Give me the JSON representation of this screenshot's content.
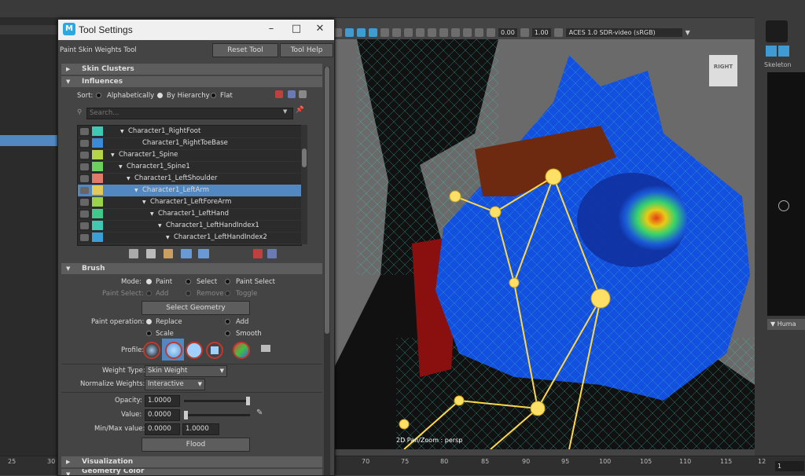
{
  "window": {
    "title": "Tool Settings",
    "tool_name": "Paint Skin Weights Tool",
    "reset_label": "Reset Tool",
    "help_label": "Tool Help",
    "logo": "M"
  },
  "sections": {
    "skin_clusters": "Skin Clusters",
    "influences": "Influences",
    "brush": "Brush",
    "visualization": "Visualization",
    "geometry_color": "Geometry Color"
  },
  "sort": {
    "label": "Sort:",
    "options": [
      "Alphabetically",
      "By Hierarchy",
      "Flat"
    ],
    "selected": "By Hierarchy"
  },
  "search": {
    "placeholder": "Search..."
  },
  "influences": [
    {
      "name": "Character1_RightFoot",
      "color": "#3fc9b5",
      "indent": 64,
      "arrow": true
    },
    {
      "name": "Character1_RightToeBase",
      "color": "#3a8ad6",
      "indent": 82,
      "arrow": false
    },
    {
      "name": "Character1_Spine",
      "color": "#b6d44a",
      "indent": 52,
      "arrow": true
    },
    {
      "name": "Character1_Spine1",
      "color": "#6bd05e",
      "indent": 62,
      "arrow": true
    },
    {
      "name": "Character1_LeftShoulder",
      "color": "#e07a6a",
      "indent": 72,
      "arrow": true
    },
    {
      "name": "Character1_LeftArm",
      "color": "#e3c85a",
      "indent": 82,
      "arrow": true,
      "selected": true
    },
    {
      "name": "Character1_LeftForeArm",
      "color": "#9ad34a",
      "indent": 92,
      "arrow": true
    },
    {
      "name": "Character1_LeftHand",
      "color": "#3fc98a",
      "indent": 102,
      "arrow": true
    },
    {
      "name": "Character1_LeftHandIndex1",
      "color": "#3ec9b0",
      "indent": 112,
      "arrow": true
    },
    {
      "name": "Character1_LeftHandIndex2",
      "color": "#3a9fd6",
      "indent": 122,
      "arrow": true
    }
  ],
  "brush": {
    "mode_label": "Mode:",
    "modes": [
      "Paint",
      "Select",
      "Paint Select"
    ],
    "paint_select_label": "Paint Select:",
    "paint_select_options": [
      "Add",
      "Remove",
      "Toggle"
    ],
    "select_geometry": "Select Geometry",
    "paint_operation_label": "Paint operation:",
    "operations": [
      "Replace",
      "Add",
      "Scale",
      "Smooth"
    ],
    "profile_label": "Profile:",
    "weight_type_label": "Weight Type:",
    "weight_type": "Skin Weight",
    "normalize_label": "Normalize Weights:",
    "normalize": "Interactive",
    "opacity_label": "Opacity:",
    "opacity": "1.0000",
    "opacity_level": 1.0,
    "value_label": "Value:",
    "value": "0.0000",
    "value_level": 0.0,
    "minmax_label": "Min/Max value:",
    "min": "0.0000",
    "max": "1.0000",
    "flood": "Flood"
  },
  "viewport": {
    "gamma": "0.00",
    "exposure": "1.00",
    "colorspace": "ACES 1.0 SDR-video (sRGB)",
    "cube_label": "RIGHT",
    "hud": "2D Pan/Zoom : persp"
  },
  "right_panel": {
    "tab": "Skeleton",
    "section": "Huma"
  },
  "timeline": {
    "ticks": [
      "25",
      "30",
      "70",
      "75",
      "80",
      "85",
      "90",
      "95",
      "100",
      "105",
      "110",
      "115",
      "12"
    ],
    "frame": "1"
  }
}
